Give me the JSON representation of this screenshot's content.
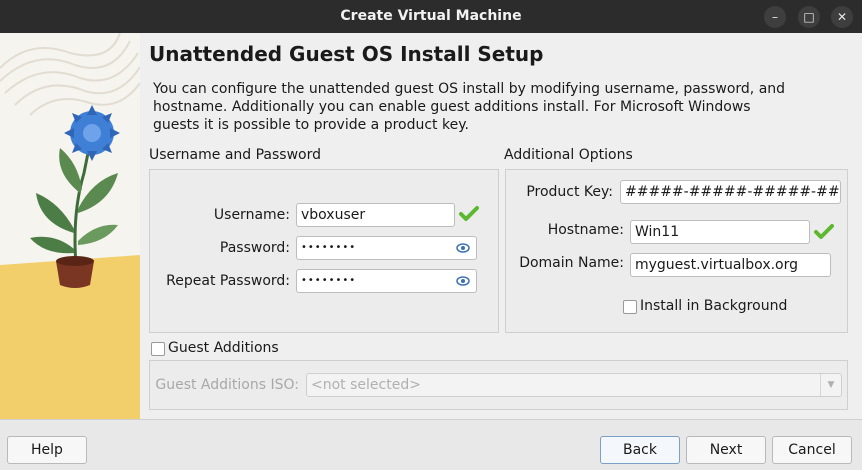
{
  "window": {
    "title": "Create Virtual Machine",
    "minimize_glyph": "–",
    "maximize_glyph": "□",
    "close_glyph": "✕"
  },
  "page": {
    "heading": "Unattended Guest OS Install Setup",
    "description": "You can configure the unattended guest OS install by modifying username, password, and hostname. Additionally you can enable guest additions install. For Microsoft Windows guests it is possible to provide a product key."
  },
  "user_group": {
    "title": "Username and Password",
    "username_label": "Username:",
    "username_value": "vboxuser",
    "password_label": "Password:",
    "password_value": "••••••••",
    "repeat_label": "Repeat Password:",
    "repeat_value": "••••••••"
  },
  "options_group": {
    "title": "Additional Options",
    "product_key_label": "Product Key:",
    "product_key_value": "#####-#####-#####-#####-",
    "hostname_label": "Hostname:",
    "hostname_value": "Win11",
    "domain_label": "Domain Name:",
    "domain_value": "myguest.virtualbox.org",
    "install_bg_label": "Install in Background",
    "install_bg_checked": false
  },
  "guest_additions": {
    "checkbox_label": "Guest Additions",
    "checked": false,
    "iso_label": "Guest Additions ISO:",
    "iso_value": "<not selected>"
  },
  "buttons": {
    "help": "Help",
    "back": "Back",
    "next": "Next",
    "cancel": "Cancel"
  },
  "colors": {
    "titlebar": "#2c2c2c",
    "valid_check": "#5cb82e",
    "eye_icon": "#3a6fb5",
    "illustration_yellow": "#f3cf6c",
    "flower_blue": "#3f7fd6"
  },
  "icons": [
    "minimize-icon",
    "maximize-icon",
    "close-icon",
    "valid-check-icon",
    "show-password-icon",
    "dropdown-arrow-icon"
  ]
}
